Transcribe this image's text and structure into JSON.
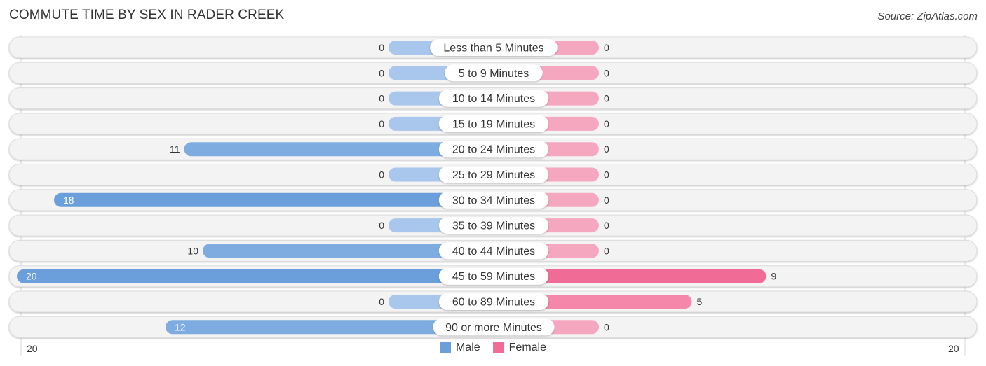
{
  "header": {
    "title": "COMMUTE TIME BY SEX IN RADER CREEK",
    "source": "Source: ZipAtlas.com"
  },
  "colors": {
    "male": "#6a9fdb",
    "male_light": "#a9c7ec",
    "female": "#f06c96",
    "female_light": "#f6a7c0",
    "track": "#f3f3f3"
  },
  "chart_data": {
    "type": "bar",
    "orientation": "horizontal-diverging",
    "title": "COMMUTE TIME BY SEX IN RADER CREEK",
    "categories": [
      "Less than 5 Minutes",
      "5 to 9 Minutes",
      "10 to 14 Minutes",
      "15 to 19 Minutes",
      "20 to 24 Minutes",
      "25 to 29 Minutes",
      "30 to 34 Minutes",
      "35 to 39 Minutes",
      "40 to 44 Minutes",
      "45 to 59 Minutes",
      "60 to 89 Minutes",
      "90 or more Minutes"
    ],
    "series": [
      {
        "name": "Male",
        "values": [
          0,
          0,
          0,
          0,
          11,
          0,
          18,
          0,
          10,
          20,
          0,
          12
        ]
      },
      {
        "name": "Female",
        "values": [
          0,
          0,
          0,
          0,
          0,
          0,
          0,
          0,
          0,
          9,
          5,
          0
        ]
      }
    ],
    "axis": {
      "left_max_label": "20",
      "right_max_label": "20",
      "max": 20
    },
    "legend": {
      "position": "bottom-center",
      "entries": [
        "Male",
        "Female"
      ]
    }
  }
}
